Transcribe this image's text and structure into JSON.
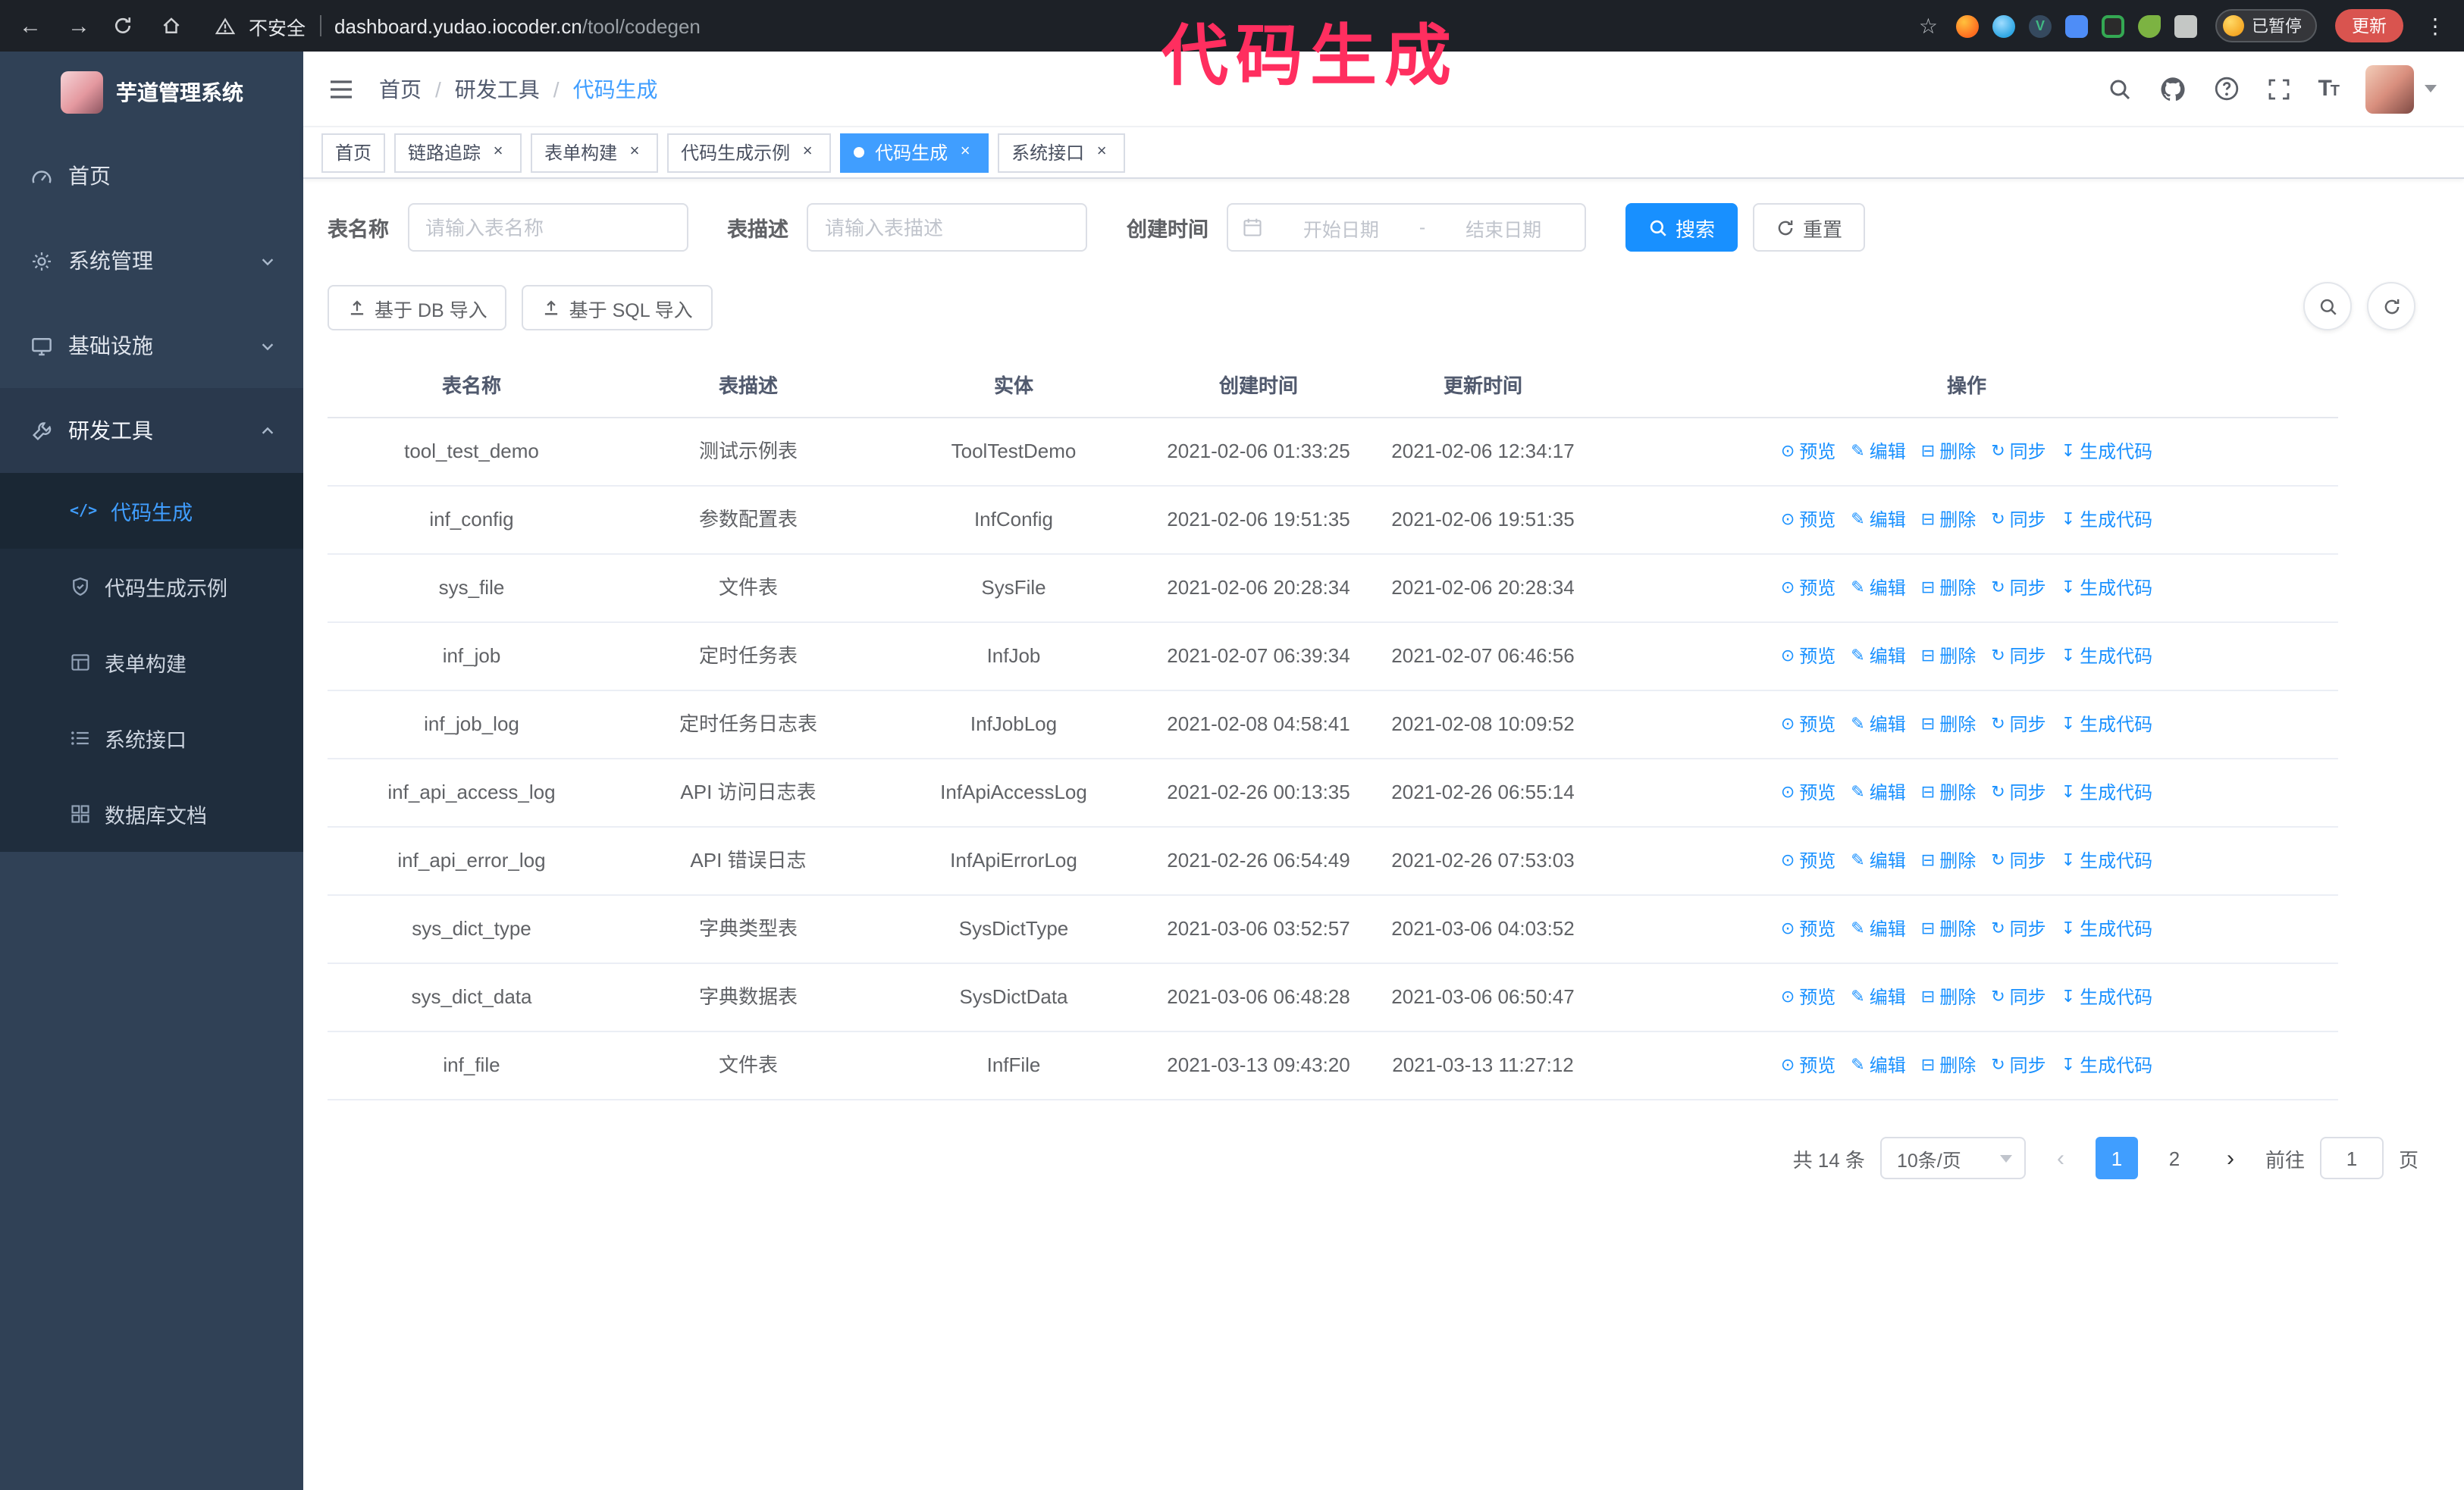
{
  "annotation": {
    "label": "代码生成",
    "color": "#ff2e5f"
  },
  "browser": {
    "security_label": "不安全",
    "url_host": "dashboard.yudao.iocoder.cn",
    "url_path": "/tool/codegen",
    "paused_badge": "已暂停",
    "update_button": "更新"
  },
  "sidebar": {
    "logo_title": "芋道管理系统",
    "items": [
      {
        "label": "首页",
        "icon": "dashboard-icon",
        "arrow": "none"
      },
      {
        "label": "系统管理",
        "icon": "gear-icon",
        "arrow": "down"
      },
      {
        "label": "基础设施",
        "icon": "monitor-icon",
        "arrow": "down"
      },
      {
        "label": "研发工具",
        "icon": "wrench-icon",
        "arrow": "up"
      }
    ],
    "sub_items": [
      {
        "label": "代码生成",
        "icon": "code-icon",
        "active": true
      },
      {
        "label": "代码生成示例",
        "icon": "shield-icon",
        "active": false
      },
      {
        "label": "表单构建",
        "icon": "form-icon",
        "active": false
      },
      {
        "label": "系统接口",
        "icon": "list-icon",
        "active": false
      },
      {
        "label": "数据库文档",
        "icon": "grid-icon",
        "active": false
      }
    ]
  },
  "breadcrumb": {
    "items": [
      "首页",
      "研发工具",
      "代码生成"
    ]
  },
  "tabs": [
    {
      "label": "首页",
      "closable": false,
      "active": false
    },
    {
      "label": "链路追踪",
      "closable": true,
      "active": false
    },
    {
      "label": "表单构建",
      "closable": true,
      "active": false
    },
    {
      "label": "代码生成示例",
      "closable": true,
      "active": false
    },
    {
      "label": "代码生成",
      "closable": true,
      "active": true
    },
    {
      "label": "系统接口",
      "closable": true,
      "active": false
    }
  ],
  "filters": {
    "table_name_label": "表名称",
    "table_name_placeholder": "请输入表名称",
    "table_desc_label": "表描述",
    "table_desc_placeholder": "请输入表描述",
    "create_time_label": "创建时间",
    "date_start_placeholder": "开始日期",
    "date_separator": "-",
    "date_end_placeholder": "结束日期",
    "search_button": "搜索",
    "reset_button": "重置"
  },
  "toolbar": {
    "import_db_button": "基于 DB 导入",
    "import_sql_button": "基于 SQL 导入"
  },
  "table": {
    "columns": [
      "表名称",
      "表描述",
      "实体",
      "创建时间",
      "更新时间",
      "操作"
    ],
    "ops": [
      {
        "label": "预览",
        "icon": "preview-icon"
      },
      {
        "label": "编辑",
        "icon": "edit-icon"
      },
      {
        "label": "删除",
        "icon": "delete-icon"
      },
      {
        "label": "同步",
        "icon": "sync-icon"
      },
      {
        "label": "生成代码",
        "icon": "generate-icon"
      }
    ],
    "rows": [
      {
        "name": "tool_test_demo",
        "desc": "测试示例表",
        "entity": "ToolTestDemo",
        "created": "2021-02-06 01:33:25",
        "updated": "2021-02-06 12:34:17"
      },
      {
        "name": "inf_config",
        "desc": "参数配置表",
        "entity": "InfConfig",
        "created": "2021-02-06 19:51:35",
        "updated": "2021-02-06 19:51:35"
      },
      {
        "name": "sys_file",
        "desc": "文件表",
        "entity": "SysFile",
        "created": "2021-02-06 20:28:34",
        "updated": "2021-02-06 20:28:34"
      },
      {
        "name": "inf_job",
        "desc": "定时任务表",
        "entity": "InfJob",
        "created": "2021-02-07 06:39:34",
        "updated": "2021-02-07 06:46:56"
      },
      {
        "name": "inf_job_log",
        "desc": "定时任务日志表",
        "entity": "InfJobLog",
        "created": "2021-02-08 04:58:41",
        "updated": "2021-02-08 10:09:52"
      },
      {
        "name": "inf_api_access_log",
        "desc": "API 访问日志表",
        "entity": "InfApiAccessLog",
        "created": "2021-02-26 00:13:35",
        "updated": "2021-02-26 06:55:14"
      },
      {
        "name": "inf_api_error_log",
        "desc": "API 错误日志",
        "entity": "InfApiErrorLog",
        "created": "2021-02-26 06:54:49",
        "updated": "2021-02-26 07:53:03"
      },
      {
        "name": "sys_dict_type",
        "desc": "字典类型表",
        "entity": "SysDictType",
        "created": "2021-03-06 03:52:57",
        "updated": "2021-03-06 04:03:52"
      },
      {
        "name": "sys_dict_data",
        "desc": "字典数据表",
        "entity": "SysDictData",
        "created": "2021-03-06 06:48:28",
        "updated": "2021-03-06 06:50:47"
      },
      {
        "name": "inf_file",
        "desc": "文件表",
        "entity": "InfFile",
        "created": "2021-03-13 09:43:20",
        "updated": "2021-03-13 11:27:12"
      }
    ]
  },
  "pagination": {
    "total": "共 14 条",
    "page_size": "10条/页",
    "pages": [
      "1",
      "2"
    ],
    "active_page": "1",
    "goto_label": "前往",
    "goto_value": "1",
    "goto_suffix": "页"
  }
}
